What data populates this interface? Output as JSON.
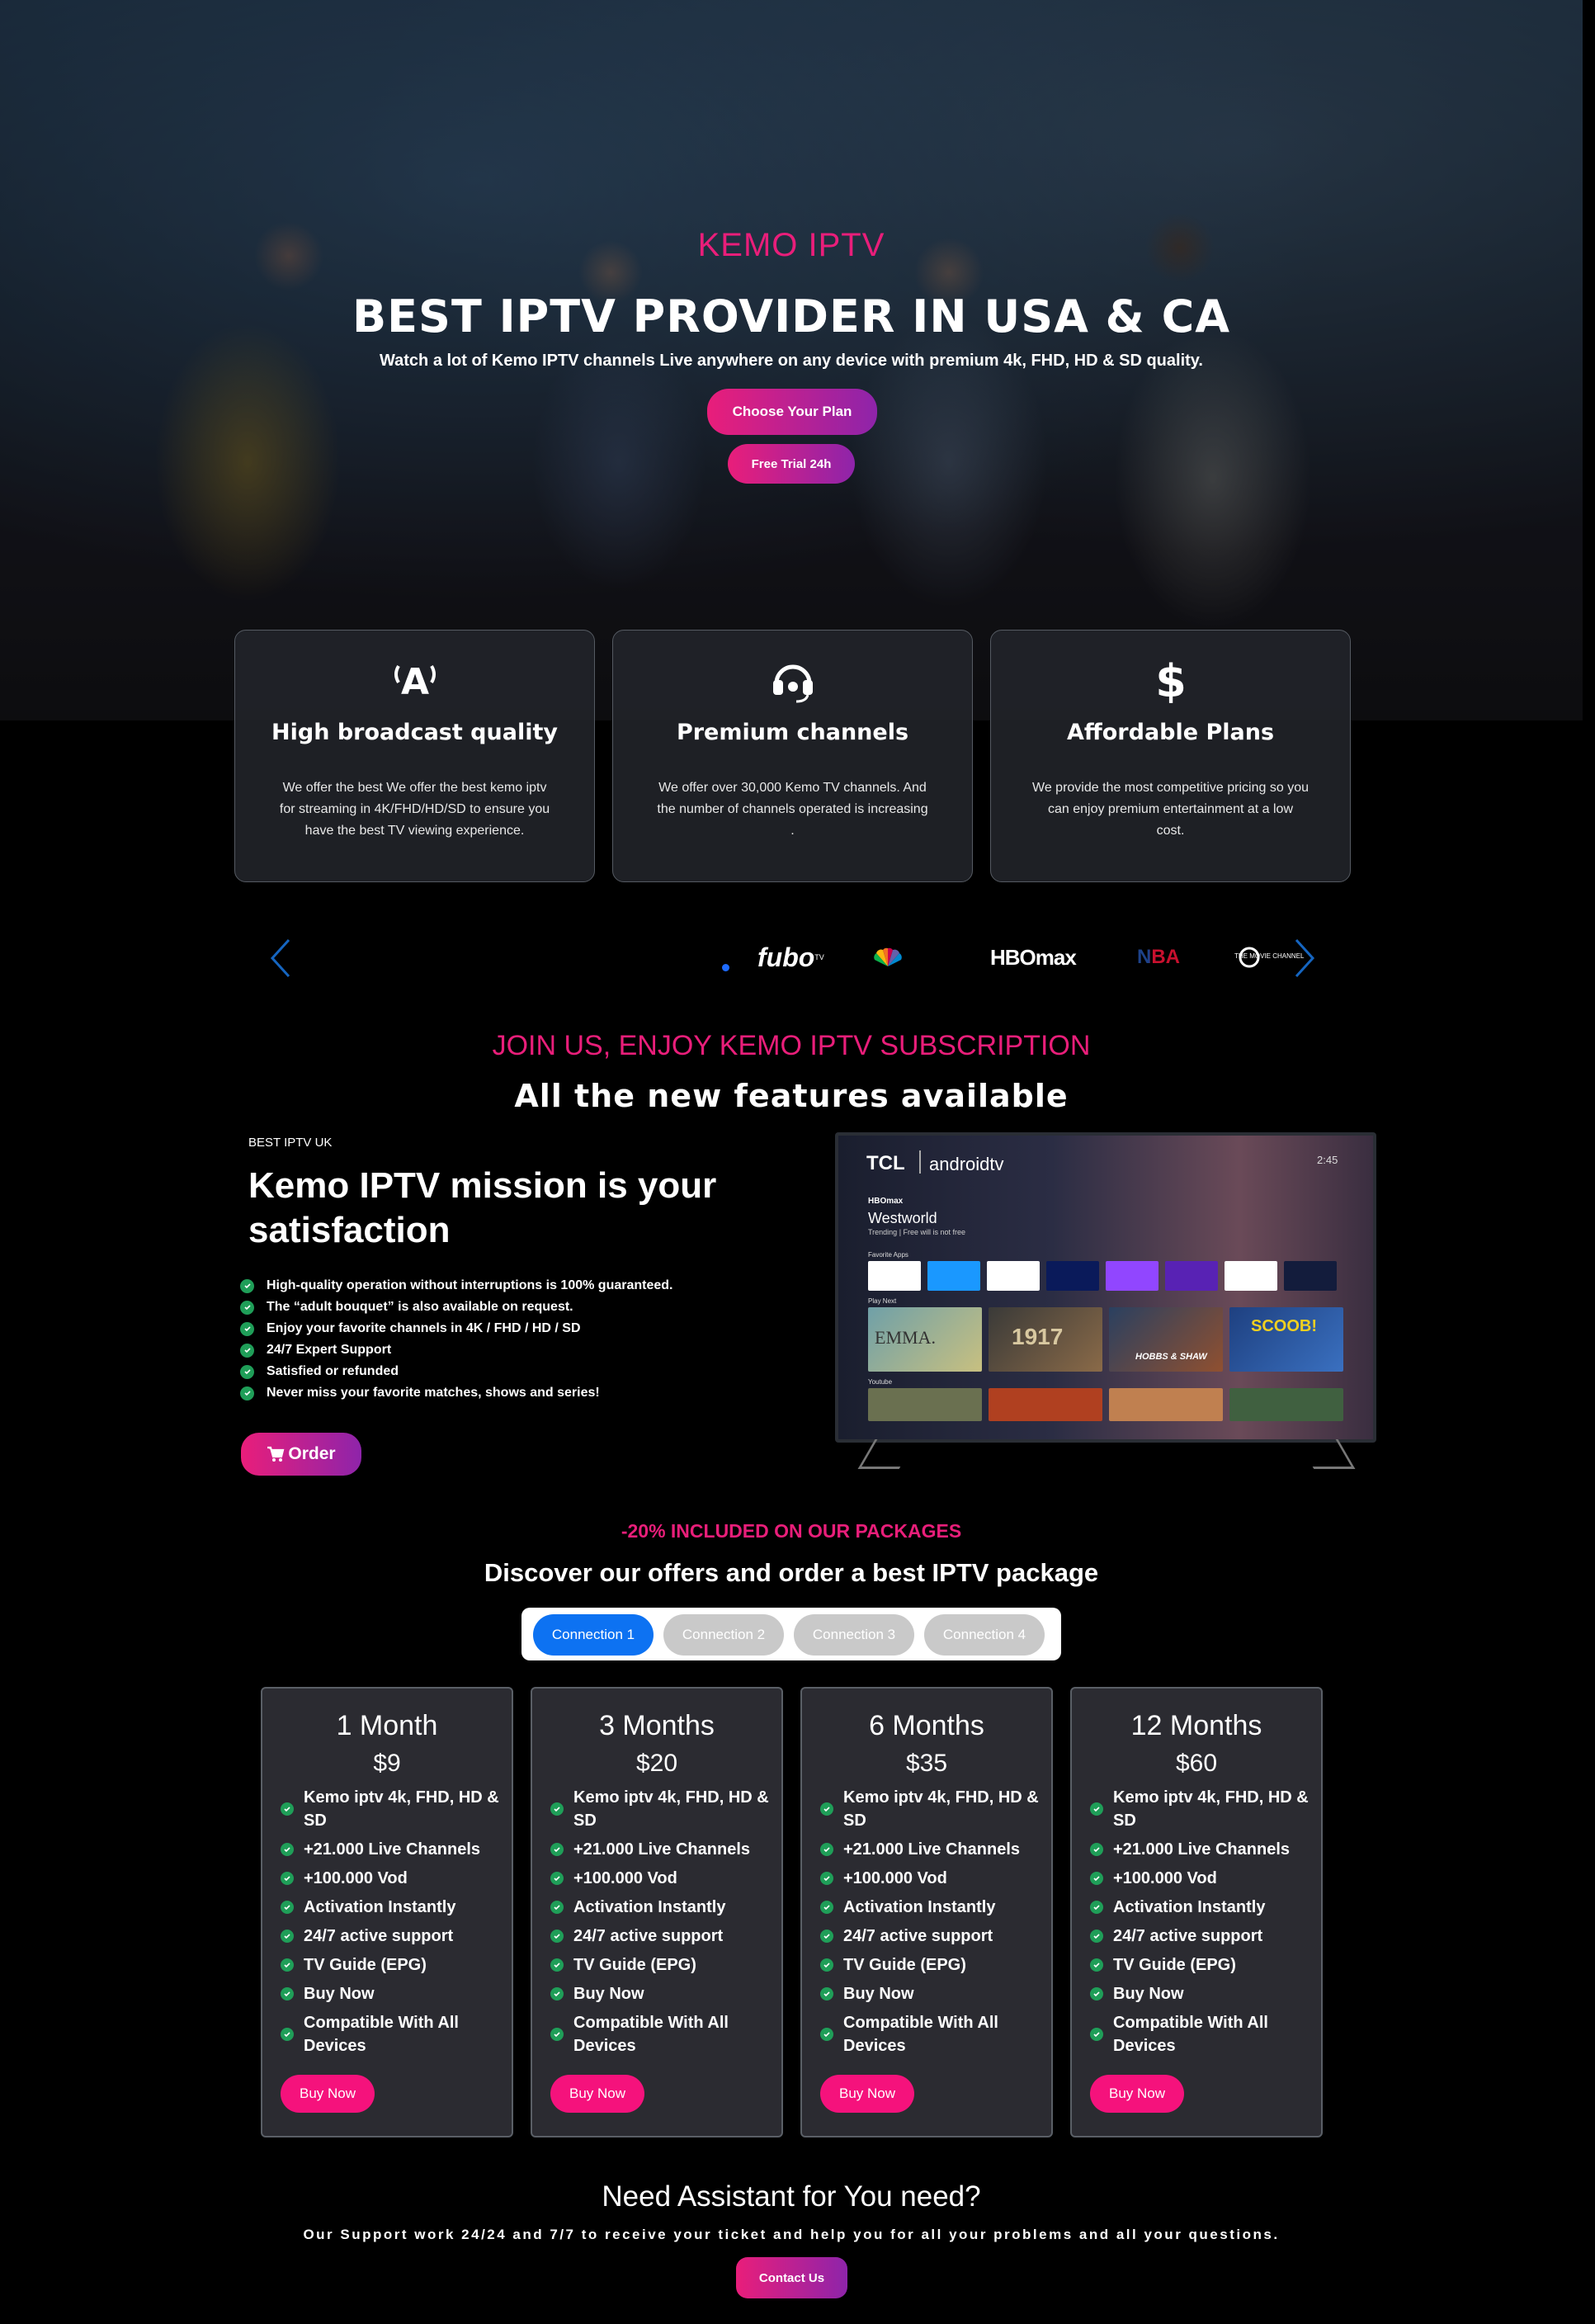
{
  "hero": {
    "brand": "KEMO IPTV",
    "headline": "BEST IPTV PROVIDER IN USA & CA",
    "subline": "Watch a lot of Kemo IPTV channels Live anywhere on any device with premium 4k, FHD, HD & SD quality.",
    "cta_plan": "Choose Your Plan",
    "cta_trial": "Free Trial 24h"
  },
  "features": [
    {
      "icon": "antenna-icon",
      "title": "High broadcast quality",
      "desc": "We offer the best We offer the best kemo iptv for streaming in 4K/FHD/HD/SD to ensure you have the best TV viewing experience."
    },
    {
      "icon": "headset-icon",
      "title": "Premium channels",
      "desc": "We offer over 30,000 Kemo TV channels. And the number of channels operated is increasing ."
    },
    {
      "icon": "dollar-icon",
      "title": "Affordable Plans",
      "desc": "We provide the most competitive pricing so you can enjoy premium entertainment at a low cost."
    }
  ],
  "logos": {
    "fubo": "fubo",
    "fubo_sup": "TV",
    "hbomax": "HBOmax",
    "nba": "NBA",
    "movie_channel": "THE MOVIE CHANNEL"
  },
  "join": {
    "tag": "JOIN US, ENJOY KEMO IPTV SUBSCRIPTION",
    "title": "All the new features available",
    "eyebrow": "BEST IPTV UK",
    "mission": "Kemo IPTV mission is your satisfaction",
    "checks": [
      "High-quality operation without interruptions is 100% guaranteed.",
      "The “adult bouquet” is also available on request.",
      "Enjoy your favorite channels in 4K / FHD / HD / SD",
      "24/7 Expert Support",
      "Satisfied or refunded",
      "Never miss your favorite matches, shows and series!"
    ],
    "order": "Order"
  },
  "tv": {
    "brand": "TCL",
    "os": "androidtv",
    "time": "2:45",
    "provider": "HBOmax",
    "show": "Westworld",
    "show_sub": "Trending | Free will is not free",
    "row_apps": "Favorite Apps",
    "row_play": "Play Next",
    "row_youtube": "Youtube",
    "apps": [
      "YouTube",
      "prime video",
      "Google Play",
      "Disney+",
      "twitch",
      "HBOmax",
      "Google Play Movies & TV",
      "Red Bull TV"
    ],
    "movies": [
      "EMMA.",
      "1917",
      "HOBBS & SHAW",
      "SCOOB!"
    ]
  },
  "offers": {
    "tag": "-20% INCLUDED ON OUR PACKAGES",
    "title": "Discover our offers and order a best IPTV package",
    "tabs": [
      "Connection 1",
      "Connection 2",
      "Connection 3",
      "Connection 4"
    ],
    "features": [
      "Kemo iptv 4k, FHD, HD & SD",
      "+21.000 Live Channels",
      "+100.000 Vod",
      "Activation Instantly",
      "24/7 active support",
      "TV Guide (EPG)",
      "Buy Now",
      "Compatible With All Devices"
    ],
    "buy_label": "Buy Now",
    "plans": [
      {
        "name": "1 Month",
        "price": "$9"
      },
      {
        "name": "3 Months",
        "price": "$20"
      },
      {
        "name": "6 Months",
        "price": "$35"
      },
      {
        "name": "12 Months",
        "price": "$60"
      }
    ]
  },
  "support": {
    "title": "Need Assistant for You need?",
    "sub": "Our Support work 24/24 and 7/7 to receive your ticket and help you for all your problems and all your questions.",
    "cta": "Contact Us"
  },
  "colors": {
    "accent_pink": "#e91e7a",
    "accent_purple": "#8e24aa",
    "tab_active": "#0d72f2",
    "check_green": "#1f9e58",
    "buy_pink": "#f5127c"
  }
}
